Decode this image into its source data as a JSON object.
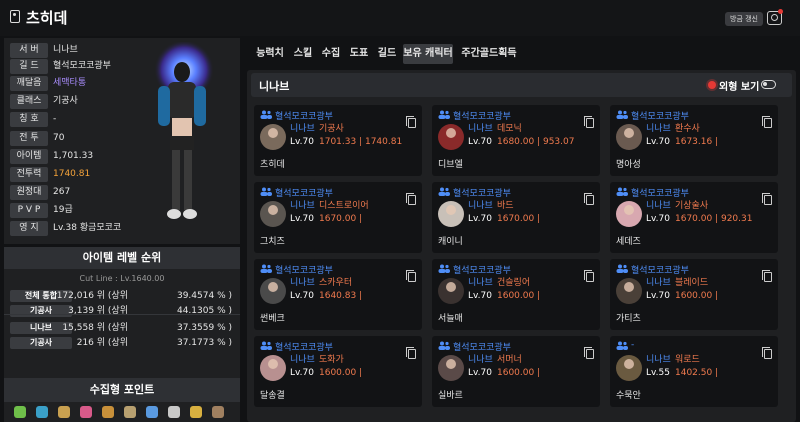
{
  "header": {
    "name": "츠히데",
    "refresh_label": "방금 갱신",
    "icons": [
      "bookmark-icon",
      "camera-icon"
    ]
  },
  "profile": {
    "stats": [
      {
        "label": "서 버",
        "value": "니나브",
        "color": "#e6e6e6"
      },
      {
        "label": "길 드",
        "value": "혈석모코코광부",
        "color": "#e6e6e6"
      },
      {
        "label": "깨달음",
        "value": "세맥타통",
        "color": "#a78bfa"
      },
      {
        "label": "클래스",
        "value": "기공사",
        "color": "#e6e6e6"
      },
      {
        "label": "칭 호",
        "value": "-",
        "color": "#e6e6e6"
      },
      {
        "label": "전 투",
        "value": "70",
        "color": "#e6e6e6"
      },
      {
        "label": "아이템",
        "value": "1,701.33",
        "color": "#e6e6e6"
      },
      {
        "label": "전투력",
        "value": "1740.81",
        "color": "#f5a33a"
      },
      {
        "label": "원정대",
        "value": "267",
        "color": "#e6e6e6"
      },
      {
        "label": "P V P",
        "value": "19급",
        "color": "#e6e6e6"
      },
      {
        "label": "영 지",
        "value": "Lv.38 황금모코코",
        "color": "#e6e6e6"
      }
    ]
  },
  "ranking": {
    "title": "아이템 레벨 순위",
    "cutline": "Cut Line : Lv.1640.00",
    "rows": [
      {
        "label": "전체 통합",
        "count": "172,016 위 (상위",
        "pct": "39.4574 % )"
      },
      {
        "label": "기공사",
        "count": "3,139 위 (상위",
        "pct": "44.1305 % )"
      },
      {
        "label": "니나브",
        "count": "15,558 위 (상위",
        "pct": "37.3559 % )"
      },
      {
        "label": "기공사",
        "count": "216 위 (상위",
        "pct": "37.1773 % )"
      }
    ]
  },
  "collect": {
    "title": "수집형 포인트",
    "icons": [
      "seed-icon",
      "island-icon",
      "map-icon",
      "heart-icon",
      "painting-icon",
      "instrument-icon",
      "leaf-icon",
      "compass-icon",
      "medal-icon",
      "scroll-icon"
    ]
  },
  "tabs": [
    "능력치",
    "스킬",
    "수집",
    "도표",
    "길드",
    "보유 캐릭터",
    "주간골드획득"
  ],
  "panel": {
    "title": "니나브",
    "outfit_label": "외형 보기"
  },
  "characters": [
    {
      "guild": "혈석모코코광부",
      "server": "니나브",
      "class": "기공사",
      "lv": "Lv.70",
      "il": "1701.33 | 1740.81",
      "name": "츠히데",
      "avatar": "#7a6a5c"
    },
    {
      "guild": "혈석모코코광부",
      "server": "니나브",
      "class": "데모닉",
      "lv": "Lv.70",
      "il": "1680.00 | 953.07",
      "name": "디브엘",
      "avatar": "#8a2a2a"
    },
    {
      "guild": "혈석모코코광부",
      "server": "니나브",
      "class": "환수사",
      "lv": "Lv.70",
      "il": "1673.16 |",
      "name": "명아성",
      "avatar": "#6a5a50"
    },
    {
      "guild": "혈석모코코광부",
      "server": "니나브",
      "class": "디스트로이어",
      "lv": "Lv.70",
      "il": "1670.00 |",
      "name": "그치즈",
      "avatar": "#5a5550"
    },
    {
      "guild": "혈석모코코광부",
      "server": "니나브",
      "class": "바드",
      "lv": "Lv.70",
      "il": "1670.00 |",
      "name": "캐이니",
      "avatar": "#c8c0b8"
    },
    {
      "guild": "혈석모코코광부",
      "server": "니나브",
      "class": "기상술사",
      "lv": "Lv.70",
      "il": "1670.00 | 920.31",
      "name": "세데즈",
      "avatar": "#d8a8b0"
    },
    {
      "guild": "혈석모코코광부",
      "server": "니나브",
      "class": "스카우터",
      "lv": "Lv.70",
      "il": "1640.83 |",
      "name": "썬베크",
      "avatar": "#4a4a4a"
    },
    {
      "guild": "혈석모코코광부",
      "server": "니나브",
      "class": "건슬링어",
      "lv": "Lv.70",
      "il": "1600.00 |",
      "name": "서늘매",
      "avatar": "#3a3230"
    },
    {
      "guild": "혈석모코코광부",
      "server": "니나브",
      "class": "블레이드",
      "lv": "Lv.70",
      "il": "1600.00 |",
      "name": "가티츠",
      "avatar": "#4a4038"
    },
    {
      "guild": "혈석모코코광부",
      "server": "니나브",
      "class": "도화가",
      "lv": "Lv.70",
      "il": "1600.00 |",
      "name": "달송결",
      "avatar": "#b89090"
    },
    {
      "guild": "혈석모코코광부",
      "server": "니나브",
      "class": "서머너",
      "lv": "Lv.70",
      "il": "1600.00 |",
      "name": "실바르",
      "avatar": "#5a4a48"
    },
    {
      "guild": "-",
      "server": "니나브",
      "class": "워로드",
      "lv": "Lv.55",
      "il": "1402.50 |",
      "name": "수묵안",
      "avatar": "#6a5a40"
    }
  ]
}
